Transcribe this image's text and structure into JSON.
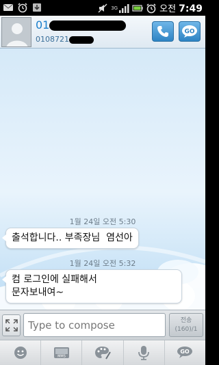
{
  "status_bar": {
    "network": "3G",
    "time_period": "오전",
    "time": "7:49",
    "icons": [
      "sms-notification-icon",
      "alarm-icon",
      "download-icon",
      "alarm-icon",
      "silent-icon",
      "signal-icon",
      "battery-icon",
      "alarm-icon"
    ]
  },
  "header": {
    "contact_name_visible": "01",
    "contact_number_visible": "0108721",
    "call_icon": "phone-icon",
    "go_label": "GO"
  },
  "messages": [
    {
      "timestamp": "1월 24일 오전 5:30",
      "text": "출석합니다.. 부족장님  염선아"
    },
    {
      "timestamp": "1월 24일 오전 5:32",
      "text_line1": "컴 로그인에 실패해서",
      "text_line2": "문자보내여~"
    }
  ],
  "compose": {
    "placeholder": "Type to compose",
    "send_label": "전송",
    "send_counter": "(160)/1"
  },
  "toolbar": {
    "items": [
      "emoticon-icon",
      "mms-icon",
      "paint-icon",
      "microphone-icon",
      "go-sms-icon"
    ],
    "mms_label": "MMS",
    "go_label": "GO"
  },
  "colors": {
    "accent": "#2e84c4",
    "contact_text": "#1a7fcc",
    "background_sky": "#d5e9f8"
  }
}
